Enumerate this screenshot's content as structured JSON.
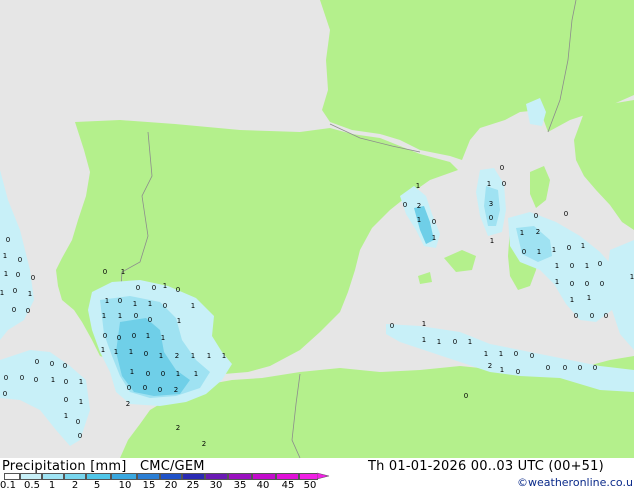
{
  "footer": {
    "title": "Precipitation [mm]",
    "model": "CMC/GEM",
    "datetime": "Th 01-01-2026 00..03 UTC (00+51)",
    "credit": "©weatheronline.co.uk"
  },
  "legend": {
    "ticks": [
      "0.1",
      "0.5",
      "1",
      "2",
      "5",
      "10",
      "15",
      "20",
      "25",
      "30",
      "35",
      "40",
      "45",
      "50"
    ],
    "colors": [
      "#ffffff",
      "#c8f0f8",
      "#a0e4f4",
      "#78d6ee",
      "#50c6e8",
      "#3aa8e0",
      "#2a7ed4",
      "#1f52c8",
      "#2a2ab4",
      "#6a1ab4",
      "#9a10c0",
      "#c20ccc",
      "#e010d8",
      "#f020e4"
    ]
  },
  "colors": {
    "land": "#b4f08c",
    "sea": "#e6e6e6",
    "border": "#8c8c8c",
    "precip_light": "#c8f0f8",
    "precip_med": "#9fe2f2",
    "precip_heavy": "#6fcfe8"
  },
  "map": {
    "point_values": [
      {
        "v": "0"
      },
      {
        "v": "1"
      },
      {
        "v": "0"
      },
      {
        "v": "1"
      },
      {
        "v": "0"
      },
      {
        "v": "0"
      },
      {
        "v": "0"
      },
      {
        "v": "1"
      },
      {
        "v": "1"
      },
      {
        "v": "0"
      },
      {
        "v": "0"
      },
      {
        "v": "0"
      },
      {
        "v": "1"
      },
      {
        "v": "0"
      },
      {
        "v": "0"
      },
      {
        "v": "1"
      },
      {
        "v": "0"
      },
      {
        "v": "1"
      },
      {
        "v": "0"
      },
      {
        "v": "1"
      },
      {
        "v": "1"
      },
      {
        "v": "0"
      },
      {
        "v": "1"
      },
      {
        "v": "1"
      },
      {
        "v": "1"
      },
      {
        "v": "1"
      },
      {
        "v": "0"
      },
      {
        "v": "0"
      },
      {
        "v": "0"
      },
      {
        "v": "0"
      },
      {
        "v": "0"
      },
      {
        "v": "1"
      },
      {
        "v": "1"
      },
      {
        "v": "1"
      },
      {
        "v": "1"
      },
      {
        "v": "0"
      },
      {
        "v": "1"
      },
      {
        "v": "2"
      },
      {
        "v": "1"
      },
      {
        "v": "1"
      },
      {
        "v": "1"
      },
      {
        "v": "1"
      },
      {
        "v": "1"
      },
      {
        "v": "0"
      },
      {
        "v": "0"
      },
      {
        "v": "1"
      },
      {
        "v": "1"
      },
      {
        "v": "0"
      },
      {
        "v": "0"
      },
      {
        "v": "0"
      },
      {
        "v": "2"
      },
      {
        "v": "2"
      },
      {
        "v": "2"
      },
      {
        "v": "2"
      },
      {
        "v": "0"
      },
      {
        "v": "0"
      },
      {
        "v": "0"
      },
      {
        "v": "0"
      },
      {
        "v": "0"
      },
      {
        "v": "0"
      },
      {
        "v": "1"
      },
      {
        "v": "0"
      },
      {
        "v": "1"
      },
      {
        "v": "0"
      },
      {
        "v": "1"
      },
      {
        "v": "1"
      },
      {
        "v": "0"
      },
      {
        "v": "0"
      },
      {
        "v": "0"
      },
      {
        "v": "0"
      },
      {
        "v": "1"
      },
      {
        "v": "0"
      },
      {
        "v": "2"
      },
      {
        "v": "1"
      },
      {
        "v": "0"
      },
      {
        "v": "1"
      },
      {
        "v": "0"
      },
      {
        "v": "1"
      },
      {
        "v": "0"
      },
      {
        "v": "3"
      },
      {
        "v": "0"
      },
      {
        "v": "1"
      },
      {
        "v": "0"
      },
      {
        "v": "0"
      },
      {
        "v": "1"
      },
      {
        "v": "2"
      },
      {
        "v": "0"
      },
      {
        "v": "1"
      },
      {
        "v": "1"
      },
      {
        "v": "0"
      },
      {
        "v": "1"
      },
      {
        "v": "1"
      },
      {
        "v": "0"
      },
      {
        "v": "1"
      },
      {
        "v": "0"
      },
      {
        "v": "1"
      },
      {
        "v": "0"
      },
      {
        "v": "0"
      },
      {
        "v": "0"
      },
      {
        "v": "1"
      },
      {
        "v": "1"
      },
      {
        "v": "0"
      },
      {
        "v": "0"
      },
      {
        "v": "0"
      },
      {
        "v": "1"
      },
      {
        "v": "0"
      },
      {
        "v": "1"
      },
      {
        "v": "1"
      },
      {
        "v": "1"
      },
      {
        "v": "0"
      },
      {
        "v": "1"
      },
      {
        "v": "1"
      },
      {
        "v": "1"
      },
      {
        "v": "0"
      },
      {
        "v": "0"
      },
      {
        "v": "2"
      },
      {
        "v": "1"
      },
      {
        "v": "0"
      },
      {
        "v": "0"
      },
      {
        "v": "0"
      },
      {
        "v": "0"
      },
      {
        "v": "0"
      }
    ]
  }
}
